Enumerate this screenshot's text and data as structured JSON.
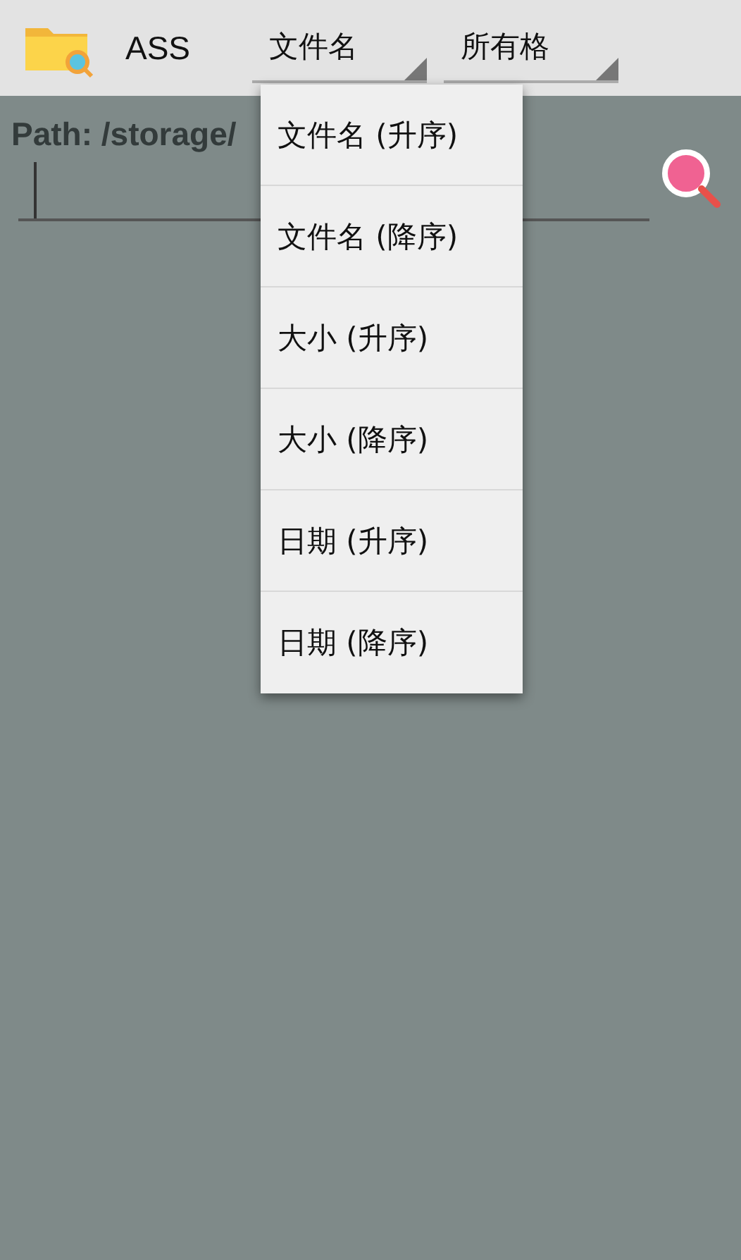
{
  "app_bar": {
    "title": "ASS",
    "spinners": [
      {
        "value": "文件名"
      },
      {
        "value": "所有格"
      }
    ]
  },
  "path": "Path: /storage/",
  "sort_menu": {
    "items": [
      {
        "label": "文件名 (升序)"
      },
      {
        "label": "文件名 (降序)"
      },
      {
        "label": "大小 (升序)"
      },
      {
        "label": "大小 (降序)"
      },
      {
        "label": "日期 (升序)"
      },
      {
        "label": "日期 (降序)"
      }
    ]
  }
}
